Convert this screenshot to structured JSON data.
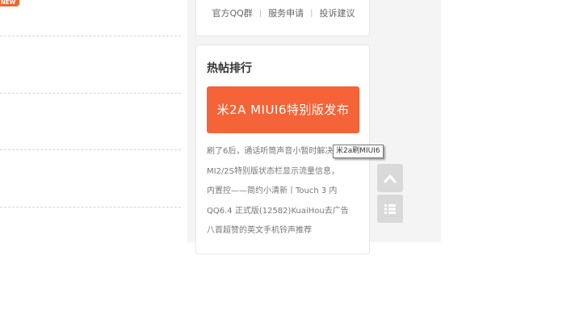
{
  "left": {
    "badge": "NEW"
  },
  "links": {
    "items": [
      "官方QQ群",
      "服务申请",
      "投诉建议"
    ],
    "separator": "|"
  },
  "hot": {
    "title": "热帖排行",
    "banner": "米2A MIUI6特别版发布",
    "items": [
      "刷了6后，通话听筒声音小暂时解决",
      "MI2/2S特别版状态栏显示流量信息，",
      "内置控——简约小清新丨Touch 3 内",
      "QQ6.4 正式版(12582)KuaiHou去广告",
      "八首超赞的英文手机铃声推荐"
    ]
  },
  "tooltip": "米2a刷MIUI6",
  "float": {
    "up_icon": "chevron-up-icon",
    "list_icon": "list-icon"
  }
}
